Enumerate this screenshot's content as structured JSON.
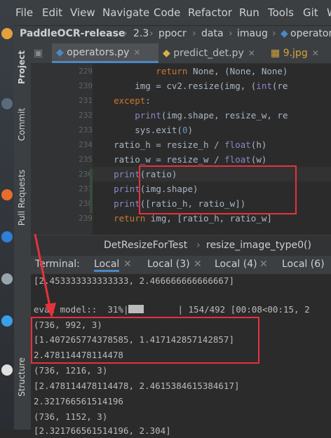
{
  "menu": [
    "File",
    "Edit",
    "View",
    "Navigate",
    "Code",
    "Refactor",
    "Run",
    "Tools",
    "Git",
    "W"
  ],
  "breadcrumb": {
    "project": "PaddleOCR-release",
    "path": [
      "2.3",
      "ppocr",
      "data",
      "imaug"
    ],
    "file": "operators"
  },
  "left_tools": [
    "Project",
    "Commit",
    "Pull Requests",
    "Structure"
  ],
  "editor_tabs": [
    {
      "label": "operators.py",
      "active": true,
      "closable": true
    },
    {
      "label": "predict_det.py",
      "active": false,
      "closable": true
    },
    {
      "label": "9.jpg",
      "active": false,
      "closable": true
    }
  ],
  "code_lines": [
    {
      "num": "229",
      "text": "            return None, (None, None)"
    },
    {
      "num": "230",
      "text": "        img = cv2.resize(img, (int(re"
    },
    {
      "num": "231",
      "text": "    except:"
    },
    {
      "num": "232",
      "text": "        print(img.shape, resize_w, re"
    },
    {
      "num": "233",
      "text": "        sys.exit(0)"
    },
    {
      "num": "234",
      "text": "    ratio_h = resize_h / float(h)"
    },
    {
      "num": "235",
      "text": "    ratio_w = resize_w / float(w)"
    },
    {
      "num": "236",
      "text": "    print(ratio)"
    },
    {
      "num": "237",
      "text": "    print(img.shape)"
    },
    {
      "num": "238",
      "text": "    print([ratio_h, ratio_w])"
    },
    {
      "num": "239",
      "text": "    return img, [ratio_h, ratio_w]"
    }
  ],
  "structure": {
    "class_name": "DetResizeForTest",
    "method_name": "resize_image_type0()"
  },
  "terminal": {
    "title": "Terminal:",
    "tabs": [
      "Local",
      "Local (3)",
      "Local (4)",
      "Local (6)"
    ],
    "lines": [
      "[2.453333333333333, 2.466666666666667]",
      "",
      "eval model::  31%",
      "(736, 992, 3)",
      "[1.407265774378585, 1.417142857142857]",
      "2.478114478114478",
      "(736, 1216, 3)",
      "[2.478114478114478, 2.4615384615384617]",
      "2.321766561514196",
      "(736, 1152, 3)",
      "[2.321766561514196, 2.304]"
    ],
    "progress_suffix": "| 154/492 [00:08<00:15, 2",
    "progress_fraction": 0.31
  },
  "colors": {
    "highlight_box": "#e8313b",
    "accent": "#4a88c7"
  }
}
